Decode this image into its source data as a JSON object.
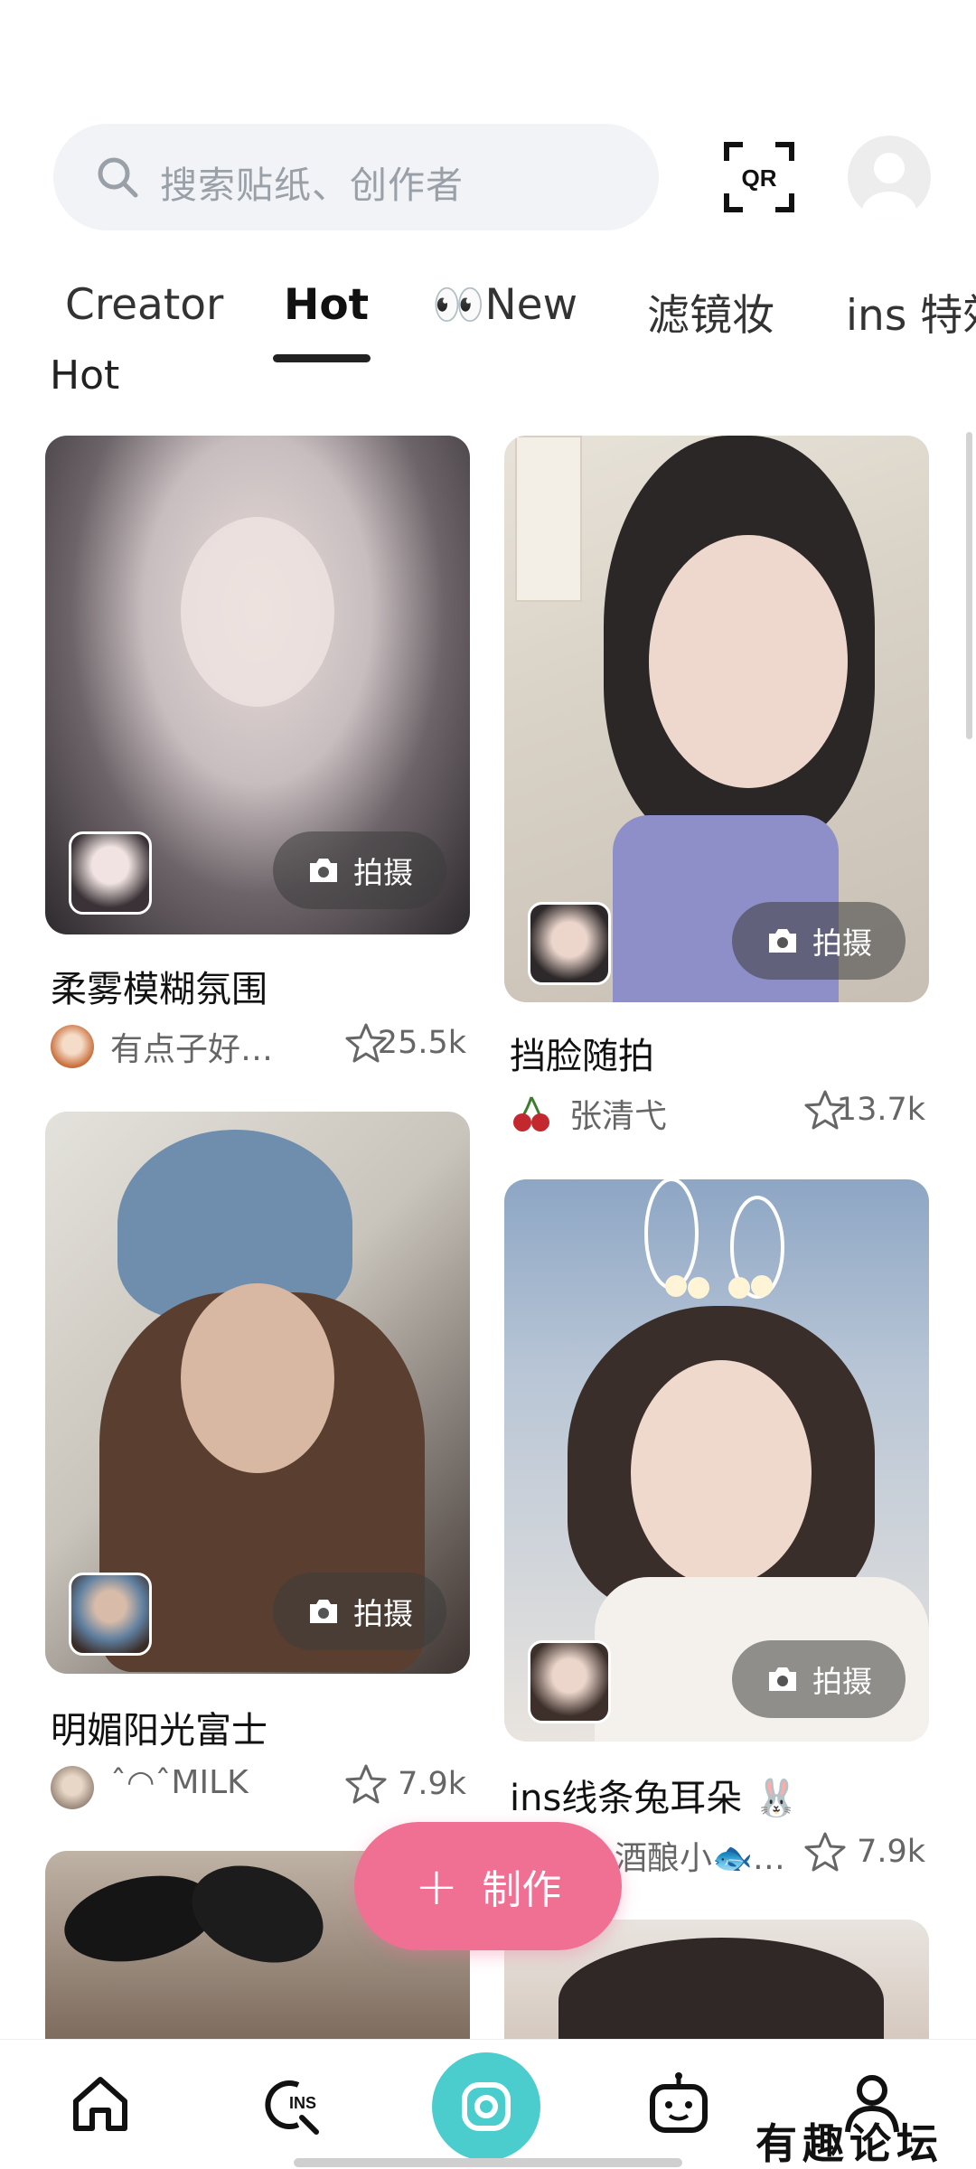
{
  "search": {
    "placeholder": "搜索贴纸、创作者"
  },
  "header": {
    "qr_label": "QR"
  },
  "tabs": [
    {
      "label": "Creator"
    },
    {
      "label": "Hot"
    },
    {
      "label": "👀New"
    },
    {
      "label": "滤镜妆"
    },
    {
      "label": "ins 特效"
    }
  ],
  "active_tab": "Hot",
  "section_title": "Hot",
  "shoot_label": "拍摄",
  "cards": [
    {
      "title": "柔雾模糊氛围",
      "user": "有点子好…",
      "likes": "25.5k"
    },
    {
      "title": "挡脸随拍",
      "user": "张清弋",
      "likes": "13.7k"
    },
    {
      "title": "明媚阳光富士",
      "user": "ˆ◠ˆMILK",
      "likes": "7.9k"
    },
    {
      "title": "ins线条兔耳朵 🐰",
      "user": "酒酿小🐟…",
      "likes": "7.9k"
    }
  ],
  "fab": {
    "label": "制作",
    "icon": "plus-icon"
  },
  "bottom_nav": [
    {
      "icon": "home-icon"
    },
    {
      "icon": "ins-search-icon"
    },
    {
      "icon": "camera-icon"
    },
    {
      "icon": "robot-icon"
    },
    {
      "icon": "profile-icon"
    }
  ],
  "watermark": "有趣论坛",
  "colors": {
    "accent_pink": "#f07094",
    "camera_teal": "#4bcdcd"
  }
}
